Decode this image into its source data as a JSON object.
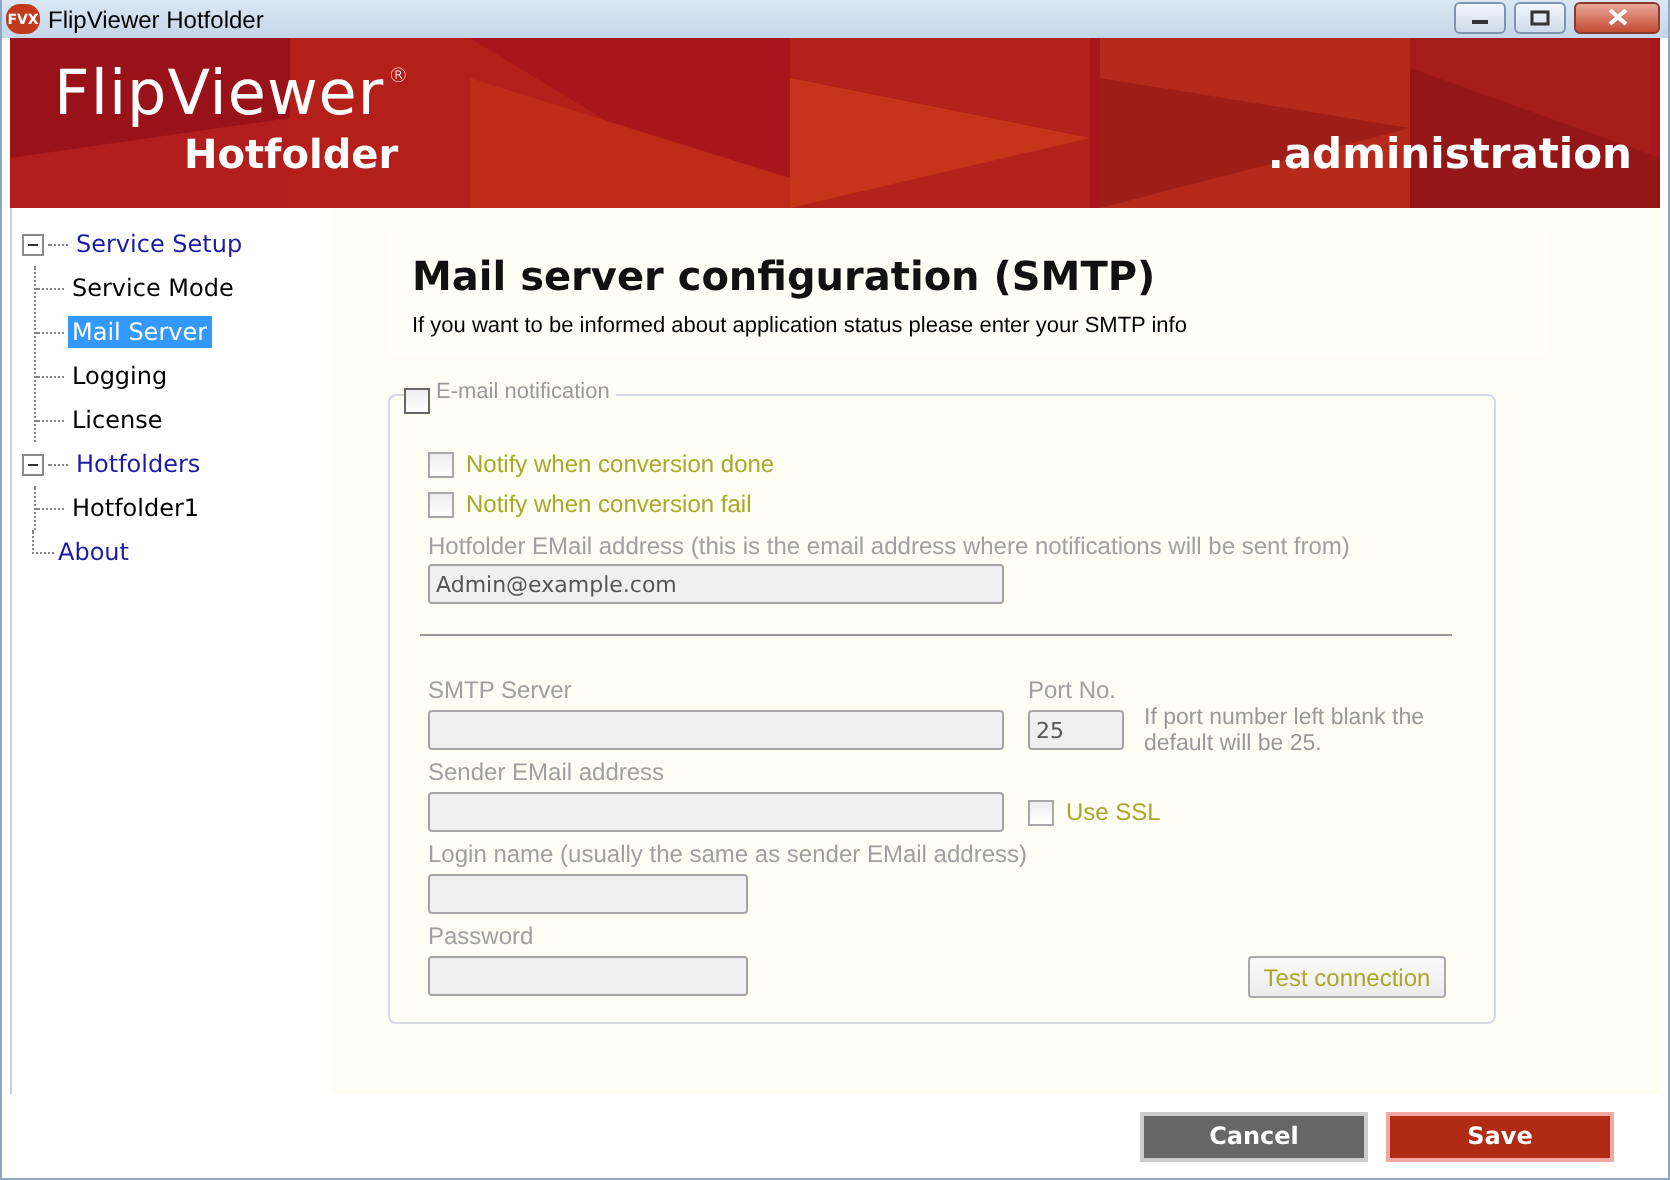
{
  "window": {
    "title": "FlipViewer Hotfolder",
    "app_icon": "FVX"
  },
  "banner": {
    "brand": "FlipViewer",
    "brand_mark": "®",
    "product": "Hotfolder",
    "section": ".administration"
  },
  "tree": [
    {
      "label": "Service Setup",
      "expanded": true,
      "selected": false,
      "children": [
        {
          "label": "Service Mode",
          "selected": false
        },
        {
          "label": "Mail Server",
          "selected": true
        },
        {
          "label": "Logging",
          "selected": false
        },
        {
          "label": "License",
          "selected": false
        }
      ]
    },
    {
      "label": "Hotfolders",
      "expanded": true,
      "selected": false,
      "children": [
        {
          "label": "Hotfolder1",
          "selected": false
        }
      ]
    },
    {
      "label": "About",
      "selected": false
    }
  ],
  "header": {
    "title": "Mail server configuration (SMTP)",
    "subtitle": "If you want to be informed about application status please enter your SMTP info"
  },
  "notification": {
    "legend": "E-mail notification",
    "checked": false,
    "disabled": true,
    "options": [
      {
        "label": "Notify when conversion done",
        "checked": false
      },
      {
        "label": "Notify when conversion fail",
        "checked": false
      }
    ],
    "hotfolder_email": {
      "label": "Hotfolder EMail address (this is the email address where notifications will be sent from)",
      "value": "Admin@example.com"
    }
  },
  "smtp": {
    "server_label": "SMTP Server",
    "port_label": "Port No.",
    "port_value": "25",
    "port_note": "If port number left blank the default will be 25.",
    "sender_label": "Sender EMail address",
    "ssl": {
      "label": "Use SSL",
      "checked": false
    },
    "login_label": "Login name (usually the same as sender EMail address)",
    "password_label": "Password",
    "test_button": "Test connection"
  },
  "buttons": [
    {
      "label": "Cancel",
      "kind": "secondary"
    },
    {
      "label": "Save",
      "kind": "primary"
    }
  ]
}
